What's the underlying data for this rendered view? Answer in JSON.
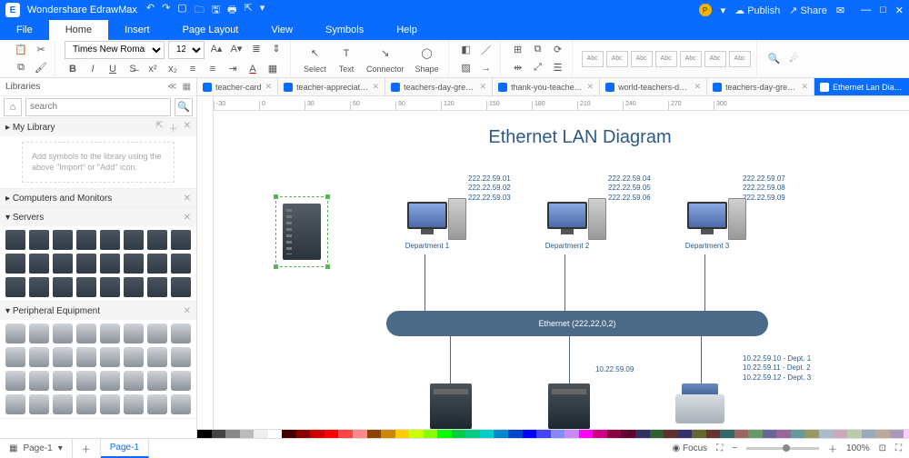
{
  "titlebar": {
    "app_name": "Wondershare EdrawMax",
    "user_initial": "P",
    "publish": "Publish",
    "share": "Share"
  },
  "menu": {
    "items": [
      "File",
      "Home",
      "Insert",
      "Page Layout",
      "View",
      "Symbols",
      "Help"
    ],
    "active": 1
  },
  "ribbon": {
    "font_family": "Times New Roman",
    "font_size": "12",
    "tool_select": "Select",
    "tool_text": "Text",
    "tool_connector": "Connector",
    "tool_shape": "Shape",
    "style_label": "Abc"
  },
  "libraries": {
    "title": "Libraries",
    "search_placeholder": "search",
    "cats": [
      {
        "name": "My Library",
        "empty_hint": "Add symbols to the library using the above \"Import\" or \"Add\" icon."
      },
      {
        "name": "Computers and Monitors"
      },
      {
        "name": "Servers"
      },
      {
        "name": "Peripheral Equipment"
      }
    ]
  },
  "doc_tabs": [
    {
      "label": "teacher-card"
    },
    {
      "label": "teacher-appreciati..."
    },
    {
      "label": "teachers-day-greet..."
    },
    {
      "label": "thank-you-teacher-card"
    },
    {
      "label": "world-teachers-day..."
    },
    {
      "label": "teachers-day-greet..."
    },
    {
      "label": "Ethernet Lan Diagram",
      "active": true
    }
  ],
  "ruler_marks": [
    "-30",
    "0",
    "30",
    "60",
    "90",
    "120",
    "150",
    "180",
    "210",
    "240",
    "270",
    "300"
  ],
  "diagram": {
    "title": "Ethernet LAN Diagram",
    "ip_groups": [
      [
        "222.22.59.01",
        "222.22.59.02",
        "222.22.59.03"
      ],
      [
        "222.22.59.04",
        "222.22.59.05",
        "222.22.59.06"
      ],
      [
        "222.22.59.07",
        "222.22.59.08",
        "222.22.59.09"
      ]
    ],
    "departments": [
      "Department 1",
      "Department 2",
      "Department 3"
    ],
    "ethernet_label": "Ethernet (222,22,0,2)",
    "lower_ip": "10.22.59.09",
    "dept_ips": [
      "10.22.59.10 - Dept. 1",
      "10.22.59.11 - Dept. 2",
      "10.22.59.12 - Dept. 3"
    ]
  },
  "color_swatches": [
    "#000",
    "#444",
    "#888",
    "#bbb",
    "#eee",
    "#fff",
    "#400",
    "#800",
    "#c00",
    "#f00",
    "#f44",
    "#f88",
    "#840",
    "#c80",
    "#fc0",
    "#cf0",
    "#8f0",
    "#0f0",
    "#0c4",
    "#0c8",
    "#0cc",
    "#08c",
    "#04c",
    "#00f",
    "#44f",
    "#88f",
    "#c8f",
    "#f0f",
    "#c08",
    "#804",
    "#600030",
    "#303060",
    "#306030",
    "#603030",
    "#336",
    "#663",
    "#633",
    "#366",
    "#966",
    "#696",
    "#669",
    "#969",
    "#699",
    "#996",
    "#abc",
    "#cab",
    "#bca",
    "#9ab",
    "#ba9",
    "#a9b",
    "#fcf",
    "#cff",
    "#ffc"
  ],
  "status": {
    "page_label": "Page-1",
    "page_tab": "Page-1",
    "focus": "Focus",
    "zoom": "100%"
  }
}
